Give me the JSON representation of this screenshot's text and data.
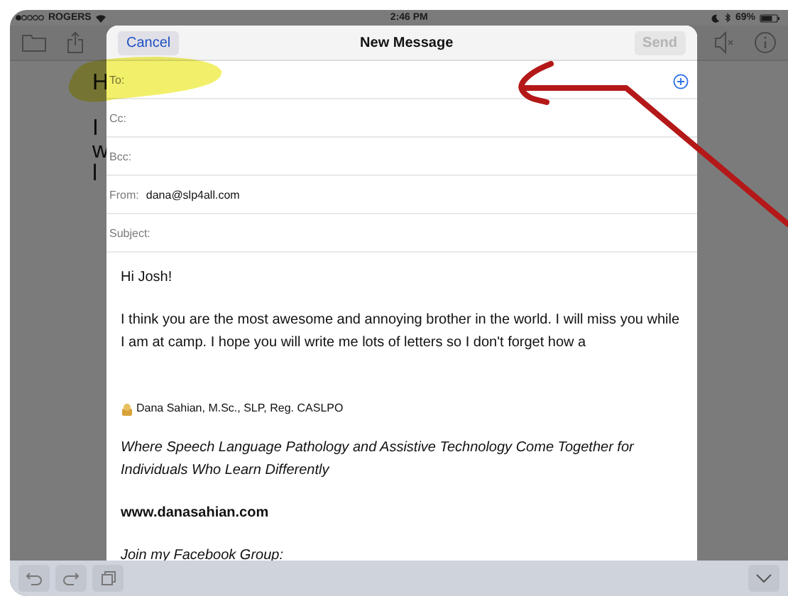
{
  "status_bar": {
    "carrier": "ROGERS",
    "time": "2:46 PM",
    "battery": "69%"
  },
  "background_note": {
    "lines": [
      "H",
      "I",
      "w",
      "l"
    ]
  },
  "compose": {
    "title": "New Message",
    "cancel": "Cancel",
    "send": {
      "label": "Send",
      "disabled": true
    },
    "fields": [
      {
        "label": "To:",
        "kind": "recipients",
        "add_button": true
      },
      {
        "label": "Cc:",
        "kind": "recipients",
        "add_button": false
      },
      {
        "label": "Bcc:",
        "kind": "recipients",
        "add_button": false
      },
      {
        "label": "From:",
        "kind": "from",
        "value": "dana@slp4all.com"
      },
      {
        "label": "Subject:",
        "kind": "subject"
      }
    ],
    "body": [
      {
        "kind": "plain",
        "text": "Hi Josh!"
      },
      {
        "kind": "plain",
        "text": "I think you are the most awesome and annoying brother in the world. I will miss you while I am at camp. I hope you will write me lots of letters so I don't forget how a"
      },
      {
        "kind": "signature",
        "text": "Dana Sahian, M.Sc., SLP, Reg. CASLPO"
      },
      {
        "kind": "italic",
        "text": "Where Speech Language Pathology and Assistive Technology Come Together for Individuals Who Learn Differently"
      },
      {
        "kind": "bold",
        "text": "www.danasahian.com"
      },
      {
        "kind": "italic",
        "text": "Join my Facebook Group:"
      }
    ]
  }
}
